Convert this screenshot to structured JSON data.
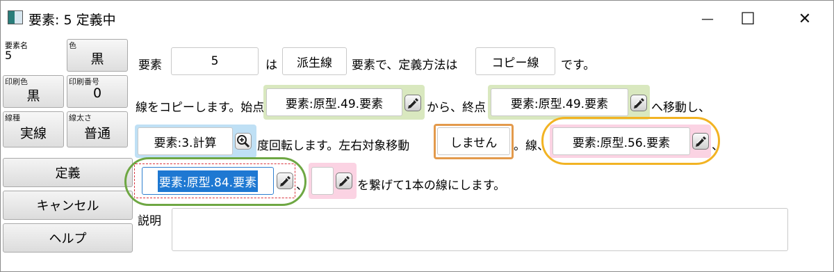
{
  "window": {
    "title": "要素: 5 定義中",
    "minimize_glyph": "—",
    "maximize_glyph": "☐",
    "close_glyph": "✕"
  },
  "left_panel": {
    "element_name_label": "要素名",
    "element_name_value": "5",
    "color_label": "色",
    "color_value": "黒",
    "print_color_label": "印刷色",
    "print_color_value": "黒",
    "print_number_label": "印刷番号",
    "print_number_value": "0",
    "line_type_label": "線種",
    "line_type_value": "実線",
    "line_width_label": "線太さ",
    "line_width_value": "普通"
  },
  "buttons": {
    "define": "定義",
    "cancel": "キャンセル",
    "help": "ヘルプ"
  },
  "row1": {
    "t1": "要素",
    "element_field": "5",
    "t2": "は",
    "kind_field": "派生線",
    "t3": "要素で、定義方法は",
    "method_field": "コピー線",
    "t4": "です。"
  },
  "row2": {
    "t1": "線をコピーします。始点",
    "start_field": "要素:原型.49.要素",
    "t2": "から、終点",
    "end_field": "要素:原型.49.要素",
    "t3": "へ移動し、"
  },
  "row3": {
    "angle_field": "要素:3.計算",
    "t1": "度回転します。左右対象移動",
    "mirror_field": "しません",
    "t2": "。線、",
    "line1_field": "要素:原型.56.要素",
    "t3": "、"
  },
  "row4": {
    "line2_field": "要素:原型.84.要素",
    "t1": "、",
    "line3_field": "",
    "t2": "を繋げて1本の線にします。"
  },
  "description": {
    "label": "説明",
    "value": ""
  },
  "colors": {
    "green_highlight": "#d9e8bf",
    "blue_highlight": "#bfe0f5",
    "pink_highlight": "#fbd3e3",
    "orange_box": "#e39a4c",
    "yellow_circle": "#f2b323",
    "green_circle": "#6ea743",
    "selection_blue": "#1e78d2",
    "dashed_red": "#d9323c"
  },
  "icons": {
    "pick": "pencil-icon",
    "zoom": "magnifier-icon"
  }
}
